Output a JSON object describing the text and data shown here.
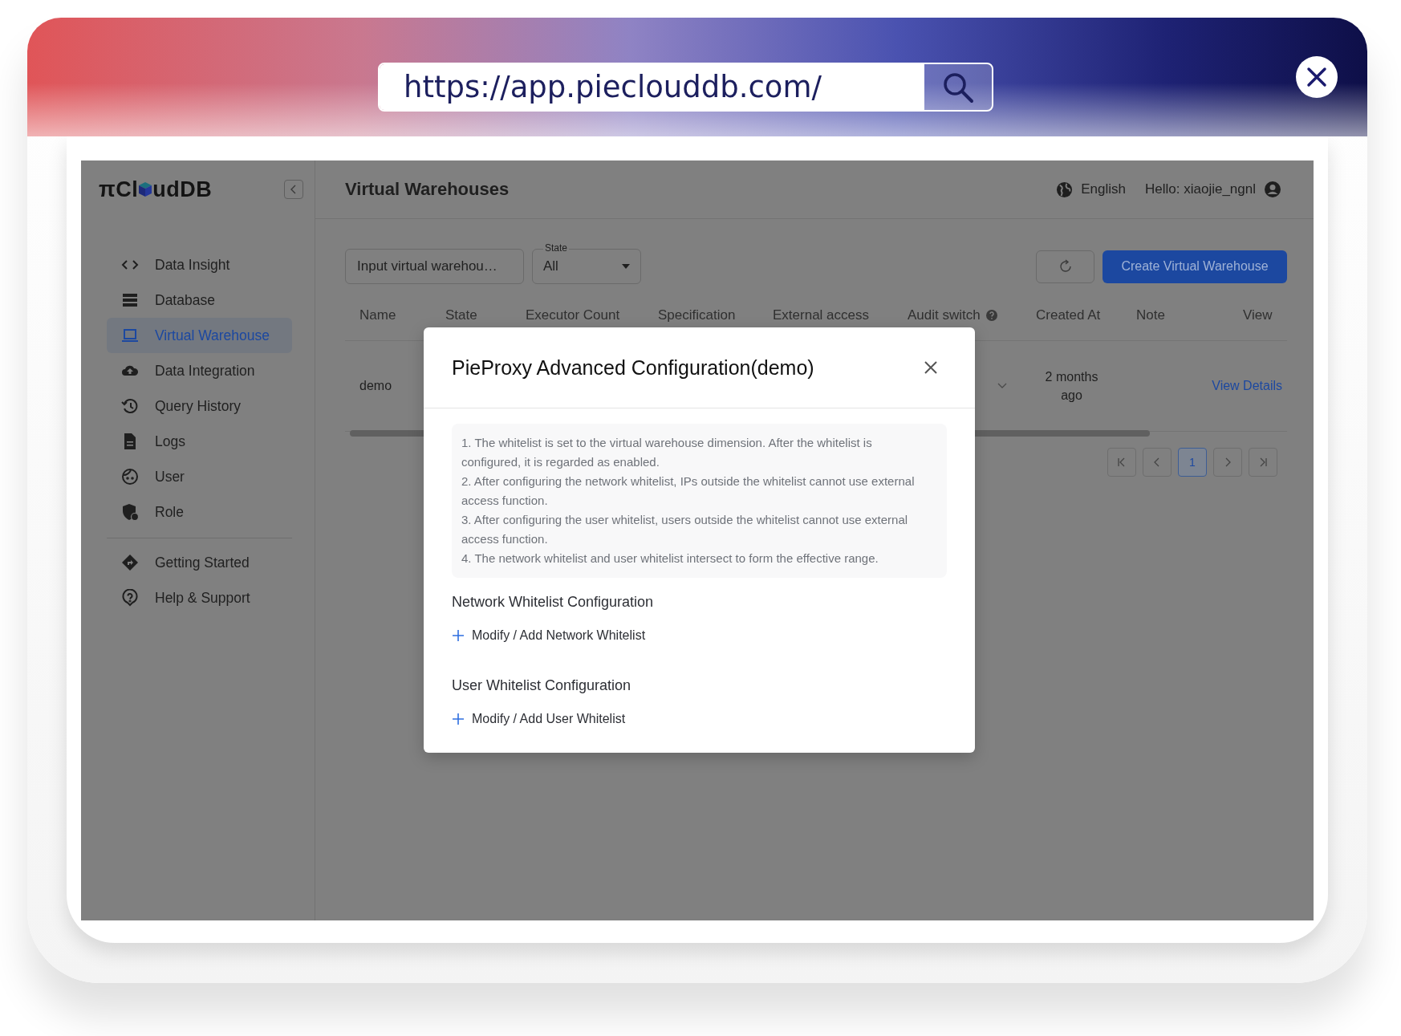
{
  "browser": {
    "url": "https://app.pieclouddb.com/"
  },
  "sidebar": {
    "logo_left": "πCl",
    "logo_right": "udDB",
    "items": [
      {
        "label": "Data Insight",
        "selected": false
      },
      {
        "label": "Database",
        "selected": false
      },
      {
        "label": "Virtual Warehouse",
        "selected": true
      },
      {
        "label": "Data Integration",
        "selected": false
      },
      {
        "label": "Query History",
        "selected": false
      },
      {
        "label": "Logs",
        "selected": false
      },
      {
        "label": "User",
        "selected": false
      },
      {
        "label": "Role",
        "selected": false
      }
    ],
    "bottom_items": [
      {
        "label": "Getting Started",
        "selected": false
      },
      {
        "label": "Help & Support",
        "selected": false
      }
    ]
  },
  "header": {
    "title": "Virtual Warehouses",
    "language": "English",
    "greeting": "Hello: xiaojie_ngnl"
  },
  "toolbar": {
    "search": {
      "placeholder": "Input virtual warehou…"
    },
    "state_filter": {
      "label": "State",
      "value": "All"
    },
    "create_button": "Create Virtual Warehouse"
  },
  "table": {
    "columns": [
      "Name",
      "State",
      "Executor Count",
      "Specification",
      "External access",
      "Audit switch",
      "Created At",
      "Note",
      "View"
    ],
    "rows": [
      {
        "name": "demo",
        "created_at": "2 months ago",
        "action": "View Details"
      }
    ]
  },
  "pagination": {
    "pages": [
      {
        "label": "1",
        "selected": true
      }
    ]
  },
  "dialog": {
    "title": "PieProxy Advanced Configuration(demo)",
    "notes": [
      "1. The whitelist is set to the virtual warehouse dimension. After the whitelist is configured, it is regarded as enabled.",
      "2. After configuring the network whitelist, IPs outside the whitelist cannot use external access function.",
      "3. After configuring the user whitelist, users outside the whitelist cannot use external access function.",
      "4. The network whitelist and user whitelist intersect to form the effective range."
    ],
    "sections": [
      {
        "title": "Network Whitelist Configuration",
        "action": "Modify / Add Network Whitelist"
      },
      {
        "title": "User Whitelist Configuration",
        "action": "Modify / Add User Whitelist"
      }
    ]
  }
}
